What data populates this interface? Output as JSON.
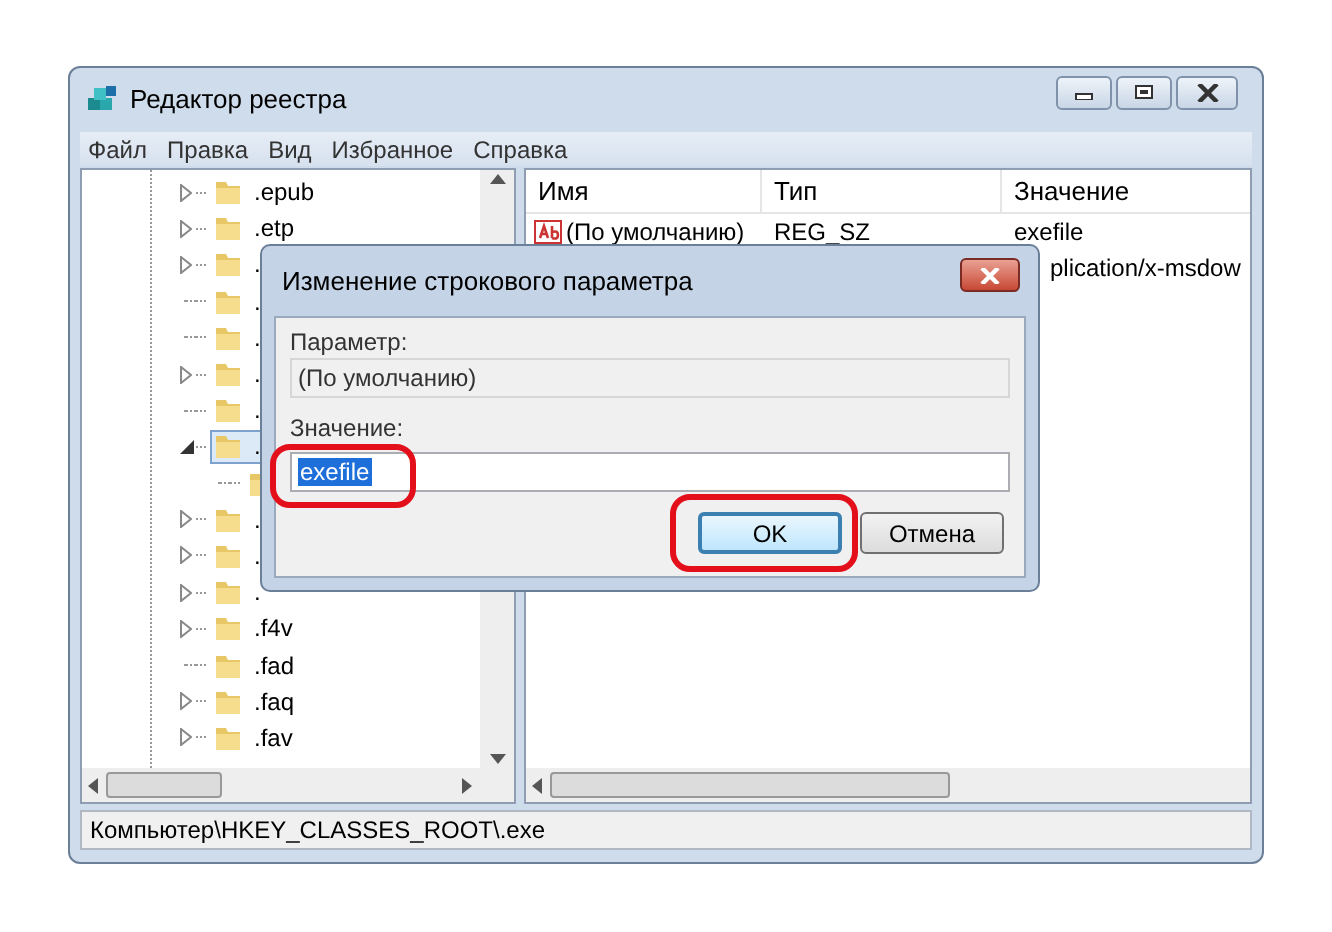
{
  "window": {
    "title": "Редактор реестра",
    "controls": [
      {
        "kind": "minimize"
      },
      {
        "kind": "maximize"
      },
      {
        "kind": "close"
      }
    ]
  },
  "menu": [
    "Файл",
    "Правка",
    "Вид",
    "Избранное",
    "Справка"
  ],
  "tree": [
    {
      "label": ".epub",
      "kind": "collapsed",
      "selected": false
    },
    {
      "label": ".etp",
      "kind": "collapsed",
      "selected": false
    },
    {
      "label": ".",
      "kind": "collapsed",
      "selected": false
    },
    {
      "label": ".",
      "kind": "leaf",
      "selected": false
    },
    {
      "label": ".",
      "kind": "leaf",
      "selected": false
    },
    {
      "label": ".",
      "kind": "collapsed",
      "selected": false
    },
    {
      "label": ".",
      "kind": "leaf",
      "selected": false
    },
    {
      "label": ".",
      "kind": "expanded",
      "selected": true,
      "children": [
        {
          "kind": "leaf",
          "selected": false
        }
      ]
    },
    {
      "label": ".",
      "kind": "collapsed",
      "selected": false
    },
    {
      "label": ".",
      "kind": "collapsed",
      "selected": false
    },
    {
      "label": ".",
      "kind": "collapsed",
      "selected": false
    },
    {
      "label": ".f4v",
      "kind": "collapsed",
      "selected": false
    },
    {
      "label": ".fad",
      "kind": "leaf",
      "selected": false
    },
    {
      "label": ".faq",
      "kind": "collapsed",
      "selected": false
    },
    {
      "label": ".fav",
      "kind": "collapsed",
      "selected": false
    }
  ],
  "list": {
    "columns": [
      "Имя",
      "Тип",
      "Значение"
    ],
    "rows": [
      {
        "name": "(По умолчанию)",
        "type": "REG_SZ",
        "value": "exefile"
      },
      {
        "value": "plication/x-msdow"
      }
    ]
  },
  "status_bar": "Компьютер\\HKEY_CLASSES_ROOT\\.exe",
  "dialog": {
    "title": "Изменение строкового параметра",
    "param_label": "Параметр:",
    "param_value": "(По умолчанию)",
    "value_label": "Значение:",
    "value": "exefile",
    "buttons": [
      {
        "label": "OK",
        "default": true
      },
      {
        "label": "Отмена",
        "default": false
      }
    ]
  },
  "annotations": [
    {
      "kind": "ring"
    },
    {
      "kind": "ring"
    }
  ]
}
